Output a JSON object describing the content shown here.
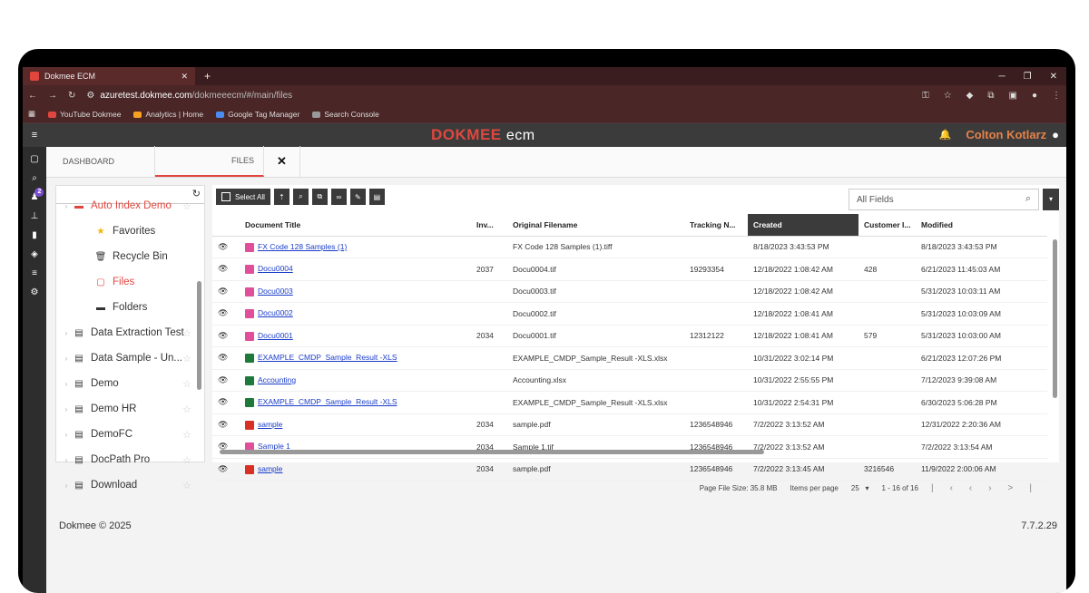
{
  "browser": {
    "tab_title": "Dokmee ECM",
    "url_host": "azuretest.dokmee.com",
    "url_path": "/dokmeeecm/#/main/files",
    "bookmarks": [
      "YouTube Dokmee",
      "Analytics | Home",
      "Google Tag Manager",
      "Search Console"
    ]
  },
  "app": {
    "logo_main": "DOKMEE",
    "logo_sub": "ecm",
    "user": "Colton Kotlarz",
    "notifications_badge": "2"
  },
  "tabs": {
    "dashboard": "DASHBOARD",
    "files": "FILES",
    "close": "✕"
  },
  "tree": {
    "items": [
      {
        "label": "Auto Index Demo",
        "icon": "folder-icon"
      },
      {
        "label": "Favorites",
        "icon": "star-icon"
      },
      {
        "label": "Recycle Bin",
        "icon": "trash-icon"
      },
      {
        "label": "Files",
        "icon": "file-icon"
      },
      {
        "label": "Folders",
        "icon": "folder-icon"
      },
      {
        "label": "Data Extraction Test",
        "icon": "cabinet-icon"
      },
      {
        "label": "Data Sample - Un...",
        "icon": "cabinet-icon"
      },
      {
        "label": "Demo",
        "icon": "cabinet-icon"
      },
      {
        "label": "Demo HR",
        "icon": "cabinet-icon"
      },
      {
        "label": "DemoFC",
        "icon": "cabinet-icon"
      },
      {
        "label": "DocPath Pro",
        "icon": "cabinet-icon"
      },
      {
        "label": "Download",
        "icon": "cabinet-icon"
      }
    ]
  },
  "toolbar": {
    "select_all": "Select All",
    "search_field": "All Fields"
  },
  "columns": [
    "Document Title",
    "Inv...",
    "Original Filename",
    "Tracking N...",
    "Created",
    "Customer I...",
    "Modified"
  ],
  "rows": [
    {
      "type": "tif",
      "title": "FX Code 128 Samples (1)",
      "inv": "",
      "orig": "FX Code 128 Samples (1).tiff",
      "track": "",
      "created": "8/18/2023 3:43:53 PM",
      "cust": "",
      "mod": "8/18/2023 3:43:53 PM"
    },
    {
      "type": "tif",
      "title": "Docu0004",
      "inv": "2037",
      "orig": "Docu0004.tif",
      "track": "19293354",
      "created": "12/18/2022 1:08:42 AM",
      "cust": "428",
      "mod": "6/21/2023 11:45:03 AM"
    },
    {
      "type": "tif",
      "title": "Docu0003",
      "inv": "",
      "orig": "Docu0003.tif",
      "track": "",
      "created": "12/18/2022 1:08:42 AM",
      "cust": "",
      "mod": "5/31/2023 10:03:11 AM"
    },
    {
      "type": "tif",
      "title": "Docu0002",
      "inv": "",
      "orig": "Docu0002.tif",
      "track": "",
      "created": "12/18/2022 1:08:41 AM",
      "cust": "",
      "mod": "5/31/2023 10:03:09 AM"
    },
    {
      "type": "tif",
      "title": "Docu0001",
      "inv": "2034",
      "orig": "Docu0001.tif",
      "track": "12312122",
      "created": "12/18/2022 1:08:41 AM",
      "cust": "579",
      "mod": "5/31/2023 10:03:00 AM"
    },
    {
      "type": "xls",
      "title": "EXAMPLE_CMDP_Sample_Result -XLS",
      "inv": "",
      "orig": "EXAMPLE_CMDP_Sample_Result -XLS.xlsx",
      "track": "",
      "created": "10/31/2022 3:02:14 PM",
      "cust": "",
      "mod": "6/21/2023 12:07:26 PM"
    },
    {
      "type": "xls",
      "title": "Accounting",
      "inv": "",
      "orig": "Accounting.xlsx",
      "track": "",
      "created": "10/31/2022 2:55:55 PM",
      "cust": "",
      "mod": "7/12/2023 9:39:08 AM"
    },
    {
      "type": "xls",
      "title": "EXAMPLE_CMDP_Sample_Result -XLS",
      "inv": "",
      "orig": "EXAMPLE_CMDP_Sample_Result -XLS.xlsx",
      "track": "",
      "created": "10/31/2022 2:54:31 PM",
      "cust": "",
      "mod": "6/30/2023 5:06:28 PM"
    },
    {
      "type": "pdf",
      "title": "sample",
      "inv": "2034",
      "orig": "sample.pdf",
      "track": "1236548946",
      "created": "7/2/2022 3:13:52 AM",
      "cust": "",
      "mod": "12/31/2022 2:20:36 AM"
    },
    {
      "type": "tif",
      "title": "Sample 1",
      "inv": "2034",
      "orig": "Sample 1.tif",
      "track": "1236548946",
      "created": "7/2/2022 3:13:52 AM",
      "cust": "",
      "mod": "7/2/2022 3:13:54 AM"
    },
    {
      "type": "pdf",
      "title": "sample",
      "inv": "2034",
      "orig": "sample.pdf",
      "track": "1236548946",
      "created": "7/2/2022 3:13:45 AM",
      "cust": "3216546",
      "mod": "11/9/2022 2:00:06 AM"
    }
  ],
  "pager": {
    "file_size": "Page File Size: 35.8 MB",
    "per_page_label": "Items per page",
    "per_page": "25",
    "range": "1 - 16 of 16"
  },
  "footer": {
    "copyright": "Dokmee © 2025",
    "version": "7.7.2.29"
  }
}
